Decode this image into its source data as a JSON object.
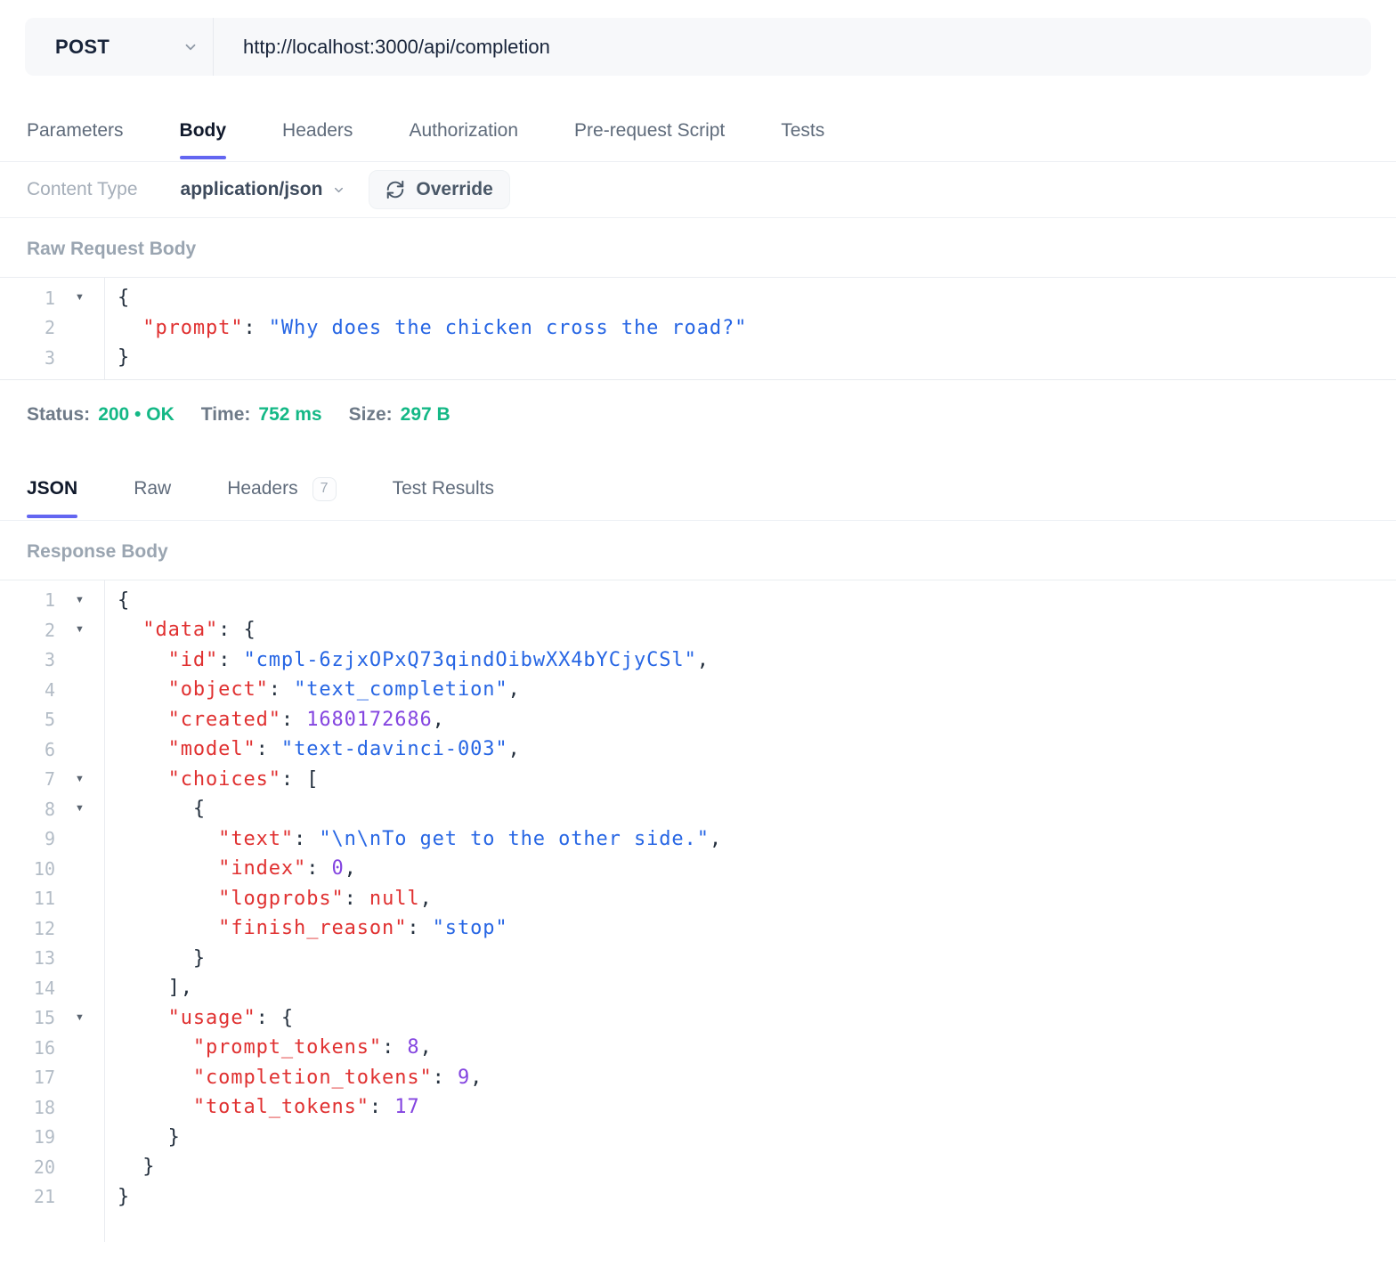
{
  "request_bar": {
    "method": "POST",
    "url": "http://localhost:3000/api/completion",
    "method_dropdown_icon": "chevron-down-icon"
  },
  "request_tabs": {
    "items": [
      {
        "label": "Parameters",
        "active": false
      },
      {
        "label": "Body",
        "active": true
      },
      {
        "label": "Headers",
        "active": false
      },
      {
        "label": "Authorization",
        "active": false
      },
      {
        "label": "Pre-request Script",
        "active": false
      },
      {
        "label": "Tests",
        "active": false
      }
    ]
  },
  "content_type_row": {
    "label": "Content Type",
    "value": "application/json",
    "dropdown_icon": "chevron-down-icon",
    "override_icon": "refresh-icon",
    "override_label": "Override"
  },
  "request_body": {
    "section_label": "Raw Request Body",
    "lines": [
      {
        "n": 1,
        "fold": true,
        "t": [
          [
            "p",
            "{"
          ]
        ]
      },
      {
        "n": 2,
        "fold": false,
        "t": [
          [
            "p",
            "  "
          ],
          [
            "k",
            "\"prompt\""
          ],
          [
            "p",
            ": "
          ],
          [
            "s",
            "\"Why does the chicken cross the road?\""
          ]
        ]
      },
      {
        "n": 3,
        "fold": false,
        "t": [
          [
            "p",
            "}"
          ]
        ]
      }
    ]
  },
  "status_bar": {
    "items": [
      {
        "label": "Status:",
        "value": "200 • OK"
      },
      {
        "label": "Time:",
        "value": "752 ms"
      },
      {
        "label": "Size:",
        "value": "297 B"
      }
    ]
  },
  "response_tabs": {
    "items": [
      {
        "label": "JSON",
        "active": true
      },
      {
        "label": "Raw",
        "active": false
      },
      {
        "label": "Headers",
        "active": false,
        "badge": "7"
      },
      {
        "label": "Test Results",
        "active": false
      }
    ]
  },
  "response_body": {
    "section_label": "Response Body",
    "lines": [
      {
        "n": 1,
        "fold": true,
        "t": [
          [
            "p",
            "{"
          ]
        ]
      },
      {
        "n": 2,
        "fold": true,
        "t": [
          [
            "p",
            "  "
          ],
          [
            "k",
            "\"data\""
          ],
          [
            "p",
            ": {"
          ]
        ]
      },
      {
        "n": 3,
        "fold": false,
        "t": [
          [
            "p",
            "    "
          ],
          [
            "k",
            "\"id\""
          ],
          [
            "p",
            ": "
          ],
          [
            "s",
            "\"cmpl-6zjxOPxQ73qindOibwXX4bYCjyCSl\""
          ],
          [
            "p",
            ","
          ]
        ]
      },
      {
        "n": 4,
        "fold": false,
        "t": [
          [
            "p",
            "    "
          ],
          [
            "k",
            "\"object\""
          ],
          [
            "p",
            ": "
          ],
          [
            "s",
            "\"text_completion\""
          ],
          [
            "p",
            ","
          ]
        ]
      },
      {
        "n": 5,
        "fold": false,
        "t": [
          [
            "p",
            "    "
          ],
          [
            "k",
            "\"created\""
          ],
          [
            "p",
            ": "
          ],
          [
            "n",
            "1680172686"
          ],
          [
            "p",
            ","
          ]
        ]
      },
      {
        "n": 6,
        "fold": false,
        "t": [
          [
            "p",
            "    "
          ],
          [
            "k",
            "\"model\""
          ],
          [
            "p",
            ": "
          ],
          [
            "s",
            "\"text-davinci-003\""
          ],
          [
            "p",
            ","
          ]
        ]
      },
      {
        "n": 7,
        "fold": true,
        "t": [
          [
            "p",
            "    "
          ],
          [
            "k",
            "\"choices\""
          ],
          [
            "p",
            ": ["
          ]
        ]
      },
      {
        "n": 8,
        "fold": true,
        "t": [
          [
            "p",
            "      {"
          ]
        ]
      },
      {
        "n": 9,
        "fold": false,
        "t": [
          [
            "p",
            "        "
          ],
          [
            "k",
            "\"text\""
          ],
          [
            "p",
            ": "
          ],
          [
            "s",
            "\"\\n\\nTo get to the other side.\""
          ],
          [
            "p",
            ","
          ]
        ]
      },
      {
        "n": 10,
        "fold": false,
        "t": [
          [
            "p",
            "        "
          ],
          [
            "k",
            "\"index\""
          ],
          [
            "p",
            ": "
          ],
          [
            "n",
            "0"
          ],
          [
            "p",
            ","
          ]
        ]
      },
      {
        "n": 11,
        "fold": false,
        "t": [
          [
            "p",
            "        "
          ],
          [
            "k",
            "\"logprobs\""
          ],
          [
            "p",
            ": "
          ],
          [
            "u",
            "null"
          ],
          [
            "p",
            ","
          ]
        ]
      },
      {
        "n": 12,
        "fold": false,
        "t": [
          [
            "p",
            "        "
          ],
          [
            "k",
            "\"finish_reason\""
          ],
          [
            "p",
            ": "
          ],
          [
            "s",
            "\"stop\""
          ]
        ]
      },
      {
        "n": 13,
        "fold": false,
        "t": [
          [
            "p",
            "      }"
          ]
        ]
      },
      {
        "n": 14,
        "fold": false,
        "t": [
          [
            "p",
            "    ],"
          ]
        ]
      },
      {
        "n": 15,
        "fold": true,
        "t": [
          [
            "p",
            "    "
          ],
          [
            "k",
            "\"usage\""
          ],
          [
            "p",
            ": {"
          ]
        ]
      },
      {
        "n": 16,
        "fold": false,
        "t": [
          [
            "p",
            "      "
          ],
          [
            "k",
            "\"prompt_tokens\""
          ],
          [
            "p",
            ": "
          ],
          [
            "n",
            "8"
          ],
          [
            "p",
            ","
          ]
        ]
      },
      {
        "n": 17,
        "fold": false,
        "t": [
          [
            "p",
            "      "
          ],
          [
            "k",
            "\"completion_tokens\""
          ],
          [
            "p",
            ": "
          ],
          [
            "n",
            "9"
          ],
          [
            "p",
            ","
          ]
        ]
      },
      {
        "n": 18,
        "fold": false,
        "t": [
          [
            "p",
            "      "
          ],
          [
            "k",
            "\"total_tokens\""
          ],
          [
            "p",
            ": "
          ],
          [
            "n",
            "17"
          ]
        ]
      },
      {
        "n": 19,
        "fold": false,
        "t": [
          [
            "p",
            "    }"
          ]
        ]
      },
      {
        "n": 20,
        "fold": false,
        "t": [
          [
            "p",
            "  }"
          ]
        ]
      },
      {
        "n": 21,
        "fold": false,
        "t": [
          [
            "p",
            "}"
          ]
        ]
      }
    ]
  },
  "colors": {
    "accent": "#6366f1",
    "success": "#14b886",
    "key": "#e03131",
    "string": "#2766e4",
    "number": "#8445e0",
    "nul": "#e03131",
    "punct": "#24303e",
    "border": "#edf0f4",
    "muted": "#9aa5b1",
    "tab": "#5f6b7b",
    "dark": "#18243a",
    "linenum": "#b3bcc6"
  }
}
